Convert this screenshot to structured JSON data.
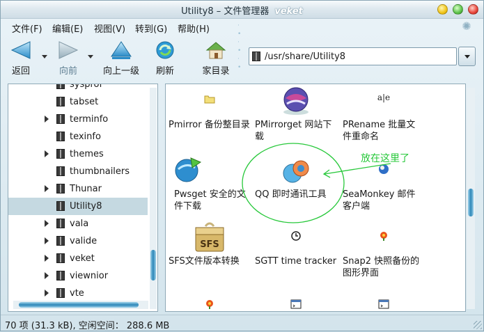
{
  "window": {
    "title": "Utility8 – 文件管理器",
    "brand": "veket"
  },
  "menubar": {
    "items": [
      "文件(F)",
      "编辑(E)",
      "视图(V)",
      "转到(G)",
      "帮助(H)"
    ]
  },
  "toolbar": {
    "back_label": "返回",
    "forward_label": "向前",
    "up_label": "向上一级",
    "refresh_label": "刷新",
    "home_label": "家目录"
  },
  "location": {
    "path": "/usr/share/Utility8"
  },
  "tree": {
    "items": [
      {
        "label": "sysprof",
        "expandable": false,
        "selected": false
      },
      {
        "label": "tabset",
        "expandable": false,
        "selected": false
      },
      {
        "label": "terminfo",
        "expandable": true,
        "selected": false
      },
      {
        "label": "texinfo",
        "expandable": false,
        "selected": false
      },
      {
        "label": "themes",
        "expandable": true,
        "selected": false
      },
      {
        "label": "thumbnailers",
        "expandable": false,
        "selected": false
      },
      {
        "label": "Thunar",
        "expandable": true,
        "selected": false
      },
      {
        "label": "Utility8",
        "expandable": false,
        "selected": true
      },
      {
        "label": "vala",
        "expandable": true,
        "selected": false
      },
      {
        "label": "valide",
        "expandable": true,
        "selected": false
      },
      {
        "label": "veket",
        "expandable": true,
        "selected": false
      },
      {
        "label": "viewnior",
        "expandable": true,
        "selected": false
      },
      {
        "label": "vte",
        "expandable": true,
        "selected": false
      }
    ]
  },
  "files": {
    "items": [
      {
        "label_lines": [
          "Pmirror 备份整目录"
        ],
        "icon": "folder-icon"
      },
      {
        "label_lines": [
          "PMirrorget 网站下",
          "载"
        ],
        "icon": "globe-icon"
      },
      {
        "label_lines": [
          "PRename 批量文",
          "件重命名"
        ],
        "icon": "rename-icon"
      },
      {
        "label_lines": [
          "Pwsget 安全的文",
          "件下载"
        ],
        "icon": "download-icon"
      },
      {
        "label_lines": [
          "QQ 即时通讯工具"
        ],
        "icon": "chat-icon"
      },
      {
        "label_lines": [
          "SeaMonkey 邮件",
          "客户端"
        ],
        "icon": "seamonkey-icon"
      },
      {
        "label_lines": [
          "SFS文件版本转换"
        ],
        "icon": "sfs-package-icon"
      },
      {
        "label_lines": [
          "SGTT time tracker"
        ],
        "icon": "clock-icon"
      },
      {
        "label_lines": [
          "Snap2 快照备份的",
          "图形界面"
        ],
        "icon": "flower-icon"
      },
      {
        "label_lines": [
          ""
        ],
        "icon": "flower-icon"
      },
      {
        "label_lines": [
          ""
        ],
        "icon": "terminal-icon"
      },
      {
        "label_lines": [
          ""
        ],
        "icon": "terminal-icon"
      }
    ]
  },
  "annotation": {
    "text": "放在这里了",
    "color": "#27c83a"
  },
  "status": {
    "text": "70 项 (31.3 kB), 空闲空间： 288.6 MB"
  }
}
